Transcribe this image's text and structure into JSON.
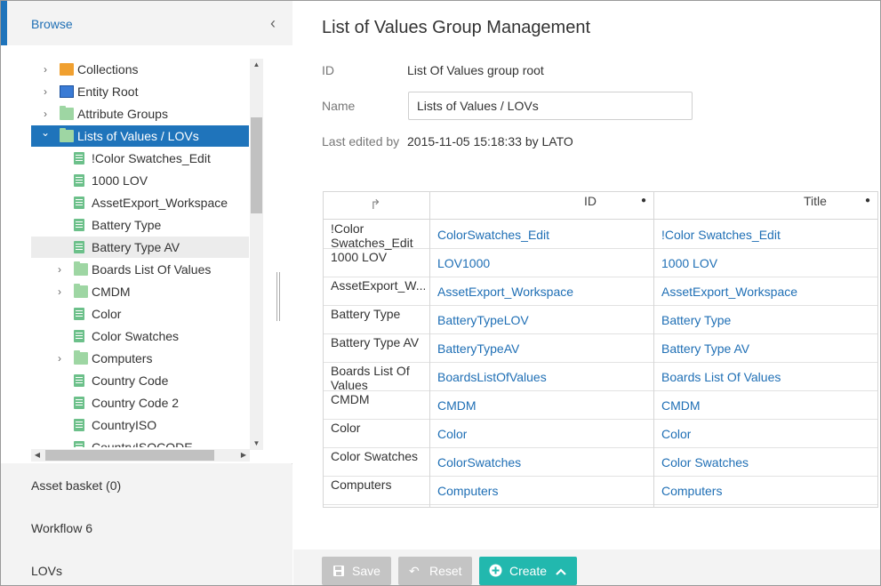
{
  "sidebar": {
    "browse_title": "Browse",
    "collapse_glyph": "‹",
    "tree": [
      {
        "label": "Collections",
        "icon": "collections-icon",
        "expandable": true,
        "level": 0
      },
      {
        "label": "Entity Root",
        "icon": "entity-icon",
        "expandable": true,
        "level": 0
      },
      {
        "label": "Attribute Groups",
        "icon": "folder-icon",
        "expandable": true,
        "level": 0
      },
      {
        "label": "Lists of Values / LOVs",
        "icon": "folder-icon",
        "expandable": true,
        "expanded": true,
        "level": 0,
        "selected": true
      },
      {
        "label": "!Color Swatches_Edit",
        "icon": "list-icon",
        "expandable": false,
        "level": 1
      },
      {
        "label": "1000 LOV",
        "icon": "list-icon",
        "expandable": false,
        "level": 1
      },
      {
        "label": "AssetExport_Workspace",
        "icon": "list-icon",
        "expandable": false,
        "level": 1
      },
      {
        "label": "Battery Type",
        "icon": "list-icon",
        "expandable": false,
        "level": 1
      },
      {
        "label": "Battery Type AV",
        "icon": "list-icon",
        "expandable": false,
        "level": 1,
        "hover": true
      },
      {
        "label": "Boards List Of Values",
        "icon": "folder-icon",
        "expandable": true,
        "level": 1
      },
      {
        "label": "CMDM",
        "icon": "folder-icon",
        "expandable": true,
        "level": 1
      },
      {
        "label": "Color",
        "icon": "list-icon",
        "expandable": false,
        "level": 1
      },
      {
        "label": "Color Swatches",
        "icon": "list-icon",
        "expandable": false,
        "level": 1
      },
      {
        "label": "Computers",
        "icon": "folder-icon",
        "expandable": true,
        "level": 1
      },
      {
        "label": "Country Code",
        "icon": "list-icon",
        "expandable": false,
        "level": 1
      },
      {
        "label": "Country Code 2",
        "icon": "list-icon",
        "expandable": false,
        "level": 1
      },
      {
        "label": "CountryISO",
        "icon": "list-icon",
        "expandable": false,
        "level": 1
      },
      {
        "label": "CountryISOCODE",
        "icon": "list-icon",
        "expandable": false,
        "level": 1
      }
    ],
    "accordion": [
      "Asset basket (0)",
      "Workflow 6",
      "LOVs"
    ]
  },
  "main": {
    "title": "List of Values Group Management",
    "id_label": "ID",
    "id_value": "List Of Values group root",
    "name_label": "Name",
    "name_value": "Lists of Values / LOVs",
    "last_edited_label": "Last edited by",
    "last_edited_value": "2015-11-05 15:18:33 by LATO",
    "grid": {
      "columns": [
        "ID",
        "Title"
      ],
      "rows": [
        {
          "key": "!Color Swatches_Edit",
          "id": "ColorSwatches_Edit",
          "title": "!Color Swatches_Edit"
        },
        {
          "key": "1000 LOV",
          "id": "LOV1000",
          "title": "1000 LOV"
        },
        {
          "key": "AssetExport_W...",
          "id": "AssetExport_Workspace",
          "title": "AssetExport_Workspace"
        },
        {
          "key": "Battery Type",
          "id": "BatteryTypeLOV",
          "title": "Battery Type"
        },
        {
          "key": "Battery Type AV",
          "id": "BatteryTypeAV",
          "title": "Battery Type AV"
        },
        {
          "key": "Boards List Of Values",
          "id": "BoardsListOfValues",
          "title": "Boards List Of Values"
        },
        {
          "key": "CMDM",
          "id": "CMDM",
          "title": "CMDM"
        },
        {
          "key": "Color",
          "id": "Color",
          "title": "Color"
        },
        {
          "key": "Color Swatches",
          "id": "ColorSwatches",
          "title": "Color Swatches"
        },
        {
          "key": "Computers",
          "id": "Computers",
          "title": "Computers"
        }
      ]
    },
    "footer": {
      "save_label": "Save",
      "reset_label": "Reset",
      "create_label": "Create"
    }
  },
  "colors": {
    "accent": "#1f74bb",
    "link": "#1f6fb5",
    "create": "#22b8ae",
    "disabled": "#c4c4c4"
  }
}
